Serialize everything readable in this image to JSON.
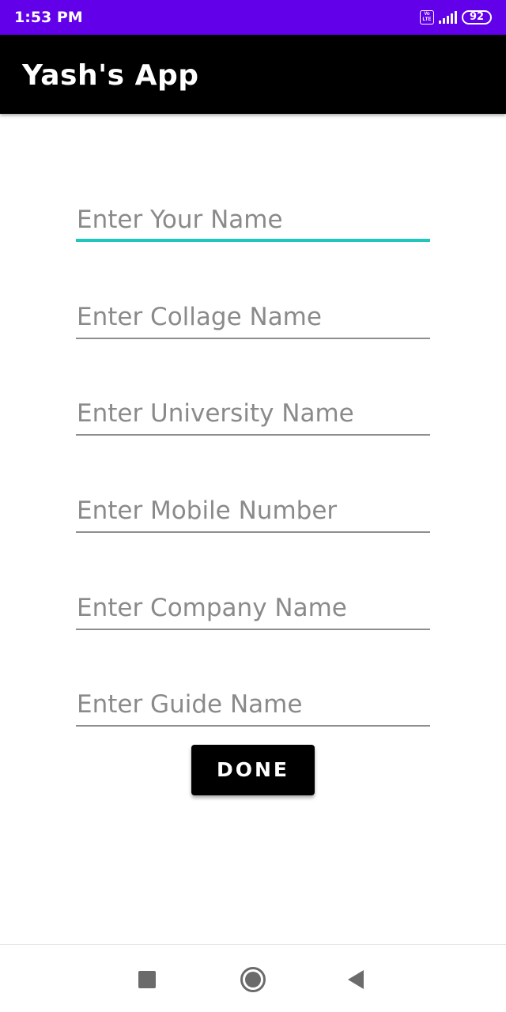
{
  "status_bar": {
    "time": "1:53 PM",
    "volte_label": "Vo LTE",
    "battery_level": "92",
    "background": "#6200ea"
  },
  "app_bar": {
    "title": "Yash's App",
    "background": "#000000"
  },
  "form": {
    "fields": [
      {
        "placeholder": "Enter Your Name",
        "value": "",
        "focused": true
      },
      {
        "placeholder": "Enter Collage Name",
        "value": ""
      },
      {
        "placeholder": "Enter University Name",
        "value": ""
      },
      {
        "placeholder": "Enter Mobile Number",
        "value": ""
      },
      {
        "placeholder": "Enter Company Name",
        "value": ""
      },
      {
        "placeholder": "Enter Guide Name",
        "value": ""
      }
    ],
    "focus_color": "#1fc6b9",
    "done_label": "DONE"
  },
  "nav_bar": {
    "icons": [
      "recents-icon",
      "home-icon",
      "back-icon"
    ]
  }
}
